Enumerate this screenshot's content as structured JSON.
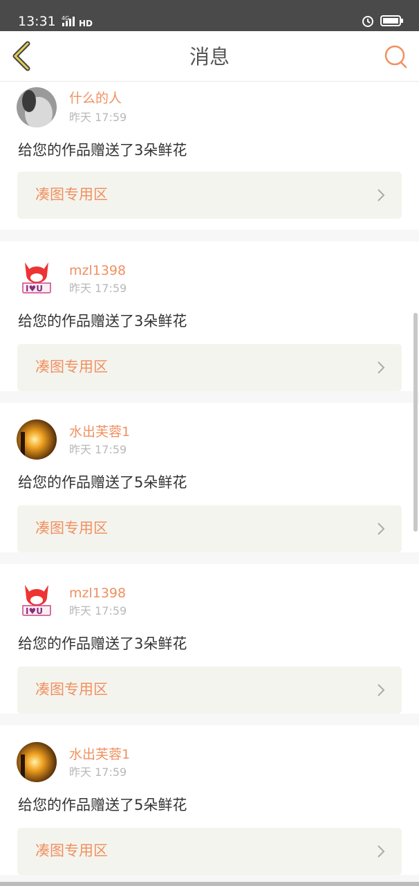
{
  "status_bar": {
    "time": "13:31",
    "network": "4G",
    "hd": "HD"
  },
  "header": {
    "title": "消息"
  },
  "messages": [
    {
      "user": "什么的人",
      "time": "昨天 17:59",
      "text": "给您的作品赠送了3朵鲜花",
      "area": "凑图专用区",
      "avatar": "gray-photo"
    },
    {
      "user": "mzl1398",
      "time": "昨天 17:59",
      "text": "给您的作品赠送了3朵鲜花",
      "area": "凑图专用区",
      "avatar": "fox-cartoon"
    },
    {
      "user": "水出芙蓉1",
      "time": "昨天 17:59",
      "text": "给您的作品赠送了5朵鲜花",
      "area": "凑图专用区",
      "avatar": "sunset-photo"
    },
    {
      "user": "mzl1398",
      "time": "昨天 17:59",
      "text": "给您的作品赠送了3朵鲜花",
      "area": "凑图专用区",
      "avatar": "fox-cartoon"
    },
    {
      "user": "水出芙蓉1",
      "time": "昨天 17:59",
      "text": "给您的作品赠送了5朵鲜花",
      "area": "凑图专用区",
      "avatar": "sunset-photo"
    }
  ],
  "colors": {
    "accent": "#f09060",
    "status_bar": "#4a4a4a"
  }
}
